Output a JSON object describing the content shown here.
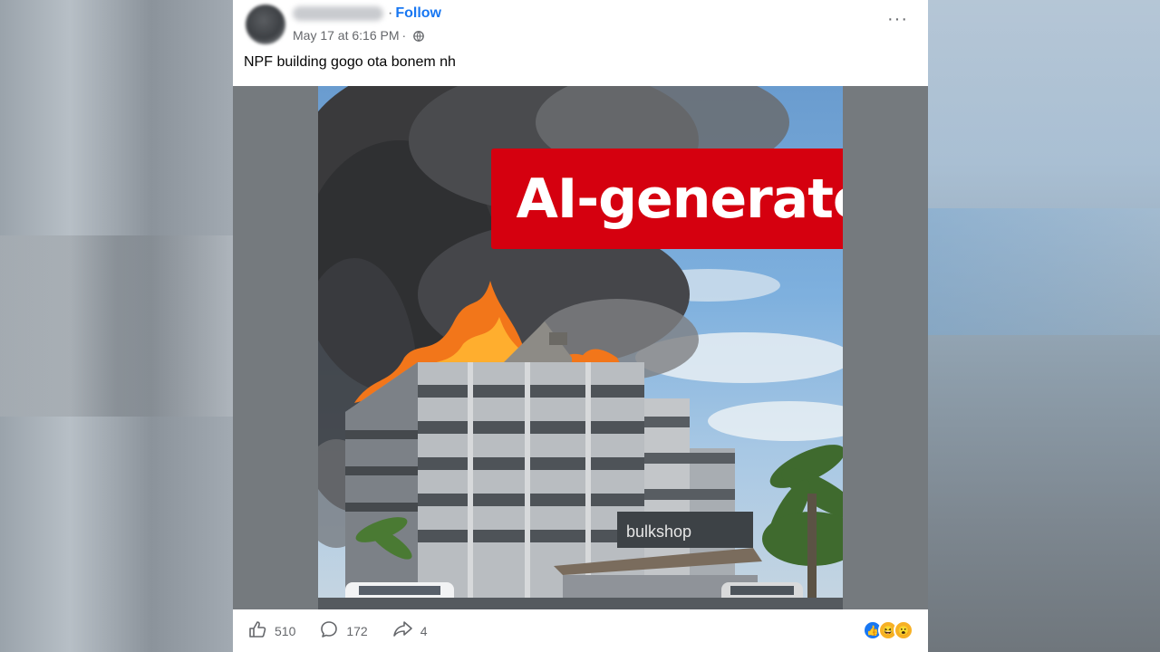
{
  "post": {
    "follow_label": "Follow",
    "separator": "·",
    "timestamp": "May 17 at 6:16 PM",
    "privacy_separator": "·",
    "more_label": "···",
    "caption": "NPF building gogo ota bonem nh"
  },
  "image": {
    "overlay_label": "AI-generated",
    "store_sign": "bulkshop"
  },
  "footer": {
    "likes_count": "510",
    "comments_count": "172",
    "shares_count": "4",
    "reactions": [
      "like",
      "haha",
      "wow"
    ]
  }
}
